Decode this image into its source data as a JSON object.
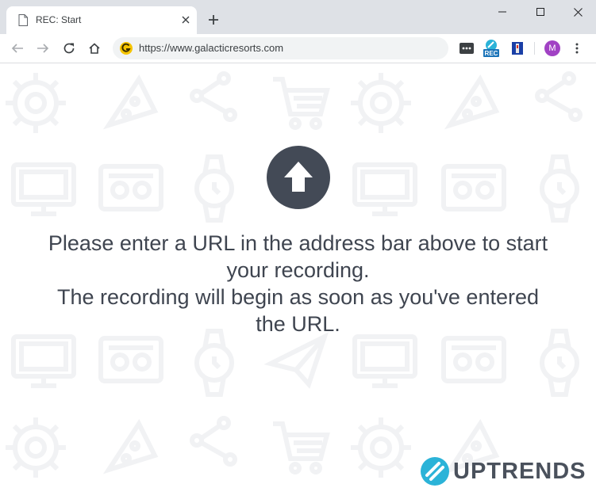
{
  "browser": {
    "tab_title": "REC: Start",
    "new_tab_symbol": "+",
    "url": "https://www.galacticresorts.com",
    "profile_initial": "M",
    "extensions": [
      "ellipsis-extension-icon",
      "rec-extension-icon",
      "flag-extension-icon"
    ],
    "rec_badge_label": "REC"
  },
  "page": {
    "message_lines": [
      "Please enter a URL in the address bar above to start",
      "your recording.",
      "The recording will begin as soon as you've entered",
      "the URL."
    ],
    "brand_name": "UPTRENDS"
  },
  "colors": {
    "accent": "#2bb3d8",
    "text": "#3f4550",
    "circle": "#434a56",
    "pattern": "#f1f2f4",
    "titlebar": "#dee1e6",
    "avatar": "#a142c4"
  }
}
